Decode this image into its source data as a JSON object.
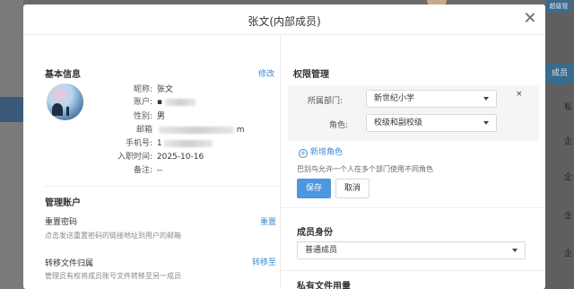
{
  "background": {
    "top_badge": "超级管",
    "members_label": "成员",
    "column_header": "私",
    "row_cells": [
      "企",
      "企",
      "企",
      "企"
    ]
  },
  "modal": {
    "title": "张文(内部成员)"
  },
  "basic_info": {
    "heading": "基本信息",
    "edit_link": "修改",
    "fields": [
      {
        "label": "昵称:",
        "value": "张文"
      },
      {
        "label": "账户:",
        "value": "▪"
      },
      {
        "label": "性别:",
        "value": "男"
      },
      {
        "label": "邮箱",
        "value": "m"
      },
      {
        "label": "手机号:",
        "value": "1"
      },
      {
        "label": "入职时间:",
        "value": "2025-10-16"
      },
      {
        "label": "备注:",
        "value": "--"
      }
    ]
  },
  "account_mgmt": {
    "heading": "管理账户",
    "reset_title": "重置密码",
    "reset_link": "重置",
    "reset_desc": "点击发送重置密码的链接地址到用户的邮箱",
    "transfer_title": "转移文件归属",
    "transfer_link": "转移至",
    "transfer_desc": "管理员有权将成员账号文件转移至另一成员"
  },
  "permissions": {
    "heading": "权限管理",
    "dept_label": "所属部门:",
    "dept_value": "新世纪小学",
    "role_label": "角色:",
    "role_value": "校级和副校级",
    "remove_symbol": "×",
    "add_role": "新增角色",
    "plus_symbol": "+",
    "hint": "巴别鸟允许一个人在多个部门使用不同角色",
    "save": "保存",
    "cancel": "取消"
  },
  "member_identity": {
    "heading": "成员身份",
    "value": "普通成员"
  },
  "private_files": {
    "heading": "私有文件用量"
  }
}
